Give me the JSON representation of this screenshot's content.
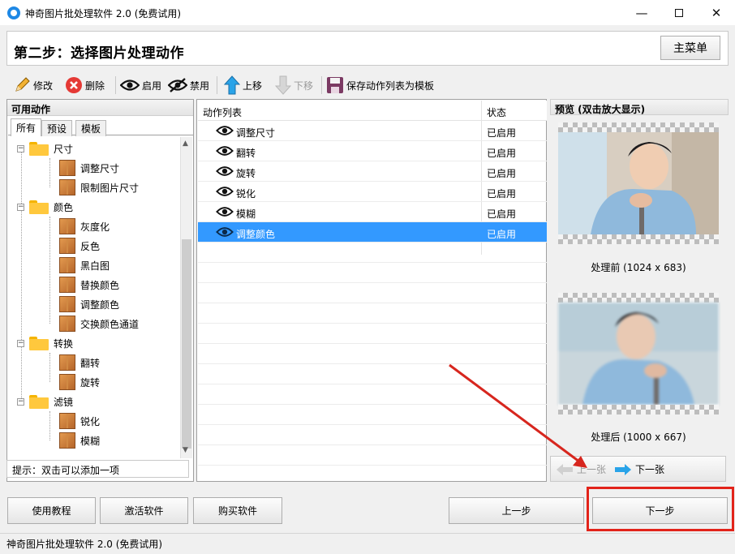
{
  "window": {
    "title": "神奇图片批处理软件 2.0 (免费试用)",
    "controls": [
      "minimize",
      "maximize",
      "close"
    ]
  },
  "header": {
    "step_title": "第二步：选择图片处理动作",
    "main_menu_label": "主菜单"
  },
  "toolbar": {
    "edit": "修改",
    "delete": "删除",
    "enable": "启用",
    "disable": "禁用",
    "move_up": "上移",
    "move_down": "下移",
    "save_template": "保存动作列表为模板"
  },
  "available_actions": {
    "title": "可用动作",
    "tabs": [
      "所有",
      "预设",
      "模板"
    ],
    "tree": [
      {
        "label": "尺寸",
        "children": [
          "调整尺寸",
          "限制图片尺寸"
        ]
      },
      {
        "label": "颜色",
        "children": [
          "灰度化",
          "反色",
          "黑白图",
          "替换颜色",
          "调整颜色",
          "交换颜色通道"
        ]
      },
      {
        "label": "转换",
        "children": [
          "翻转",
          "旋转"
        ]
      },
      {
        "label": "滤镜",
        "children": [
          "锐化",
          "模糊"
        ]
      }
    ],
    "hint": "提示：双击可以添加一项"
  },
  "action_list": {
    "col_action": "动作列表",
    "col_status": "状态",
    "rows": [
      {
        "name": "调整尺寸",
        "status": "已启用"
      },
      {
        "name": "翻转",
        "status": "已启用"
      },
      {
        "name": "旋转",
        "status": "已启用"
      },
      {
        "name": "锐化",
        "status": "已启用"
      },
      {
        "name": "模糊",
        "status": "已启用"
      },
      {
        "name": "调整颜色",
        "status": "已启用"
      }
    ],
    "selected_index": 5
  },
  "preview": {
    "title": "预览 (双击放大显示)",
    "before_caption": "处理前 (1024 x 683)",
    "after_caption": "处理后 (1000 x 667)",
    "prev_label": "上一张",
    "next_label": "下一张"
  },
  "bottom": {
    "tutorial": "使用教程",
    "activate": "激活软件",
    "buy": "购买软件",
    "prev_step": "上一步",
    "next_step": "下一步"
  },
  "statusbar": {
    "text": "神奇图片批处理软件 2.0 (免费试用)"
  },
  "colors": {
    "selection": "#3399ff",
    "highlight_box": "#e2231a"
  }
}
